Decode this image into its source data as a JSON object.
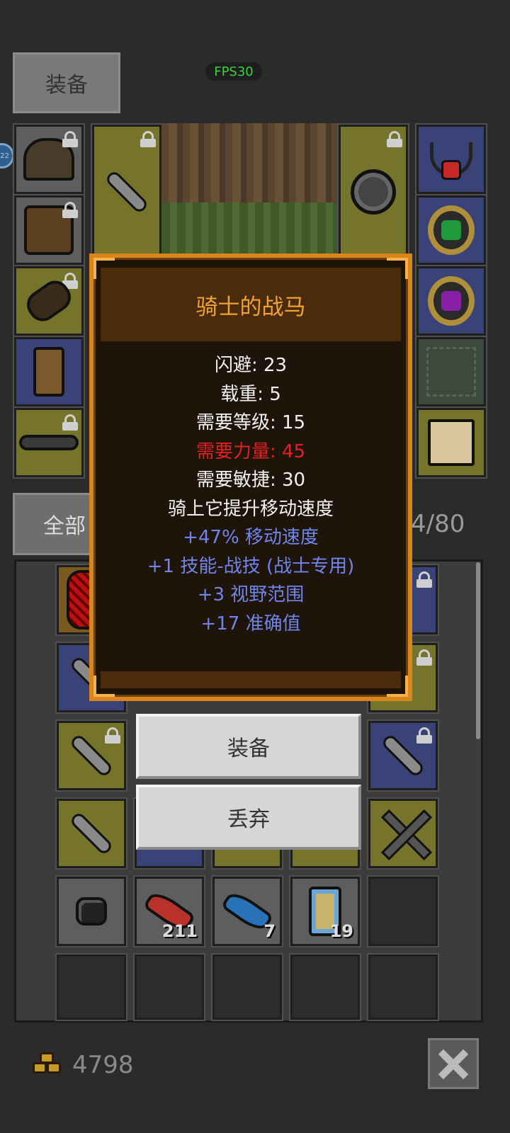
{
  "top_bar": {
    "equip_tab_label": "装备",
    "fps_label": "FPS30",
    "level_badge": "22"
  },
  "inventory": {
    "all_tab_label": "全部",
    "capacity_label": "4/80",
    "stack_counts": [
      "211",
      "7",
      "19"
    ]
  },
  "item_tooltip": {
    "name": "骑士的战马",
    "stats": [
      {
        "text": "闪避: 23",
        "color": "white"
      },
      {
        "text": "载重: 5",
        "color": "white"
      },
      {
        "text": "需要等级: 15",
        "color": "white"
      },
      {
        "text": "需要力量: 45",
        "color": "red"
      },
      {
        "text": "需要敏捷: 30",
        "color": "white"
      },
      {
        "text": "骑上它提升移动速度",
        "color": "white"
      },
      {
        "text": "+47% 移动速度",
        "color": "blue"
      },
      {
        "text": "+1 技能-战技 (战士专用)",
        "color": "blue"
      },
      {
        "text": "+3 视野范围",
        "color": "blue"
      },
      {
        "text": "+17 准确值",
        "color": "blue"
      }
    ]
  },
  "actions": {
    "equip_label": "装备",
    "discard_label": "丢弃"
  },
  "footer": {
    "gold_amount": "4798"
  },
  "colors": {
    "tooltip_border": "#d9851c",
    "tooltip_title": "#f0a235",
    "requirement_unmet": "#e52020",
    "bonus_stat": "#6f86e8"
  }
}
